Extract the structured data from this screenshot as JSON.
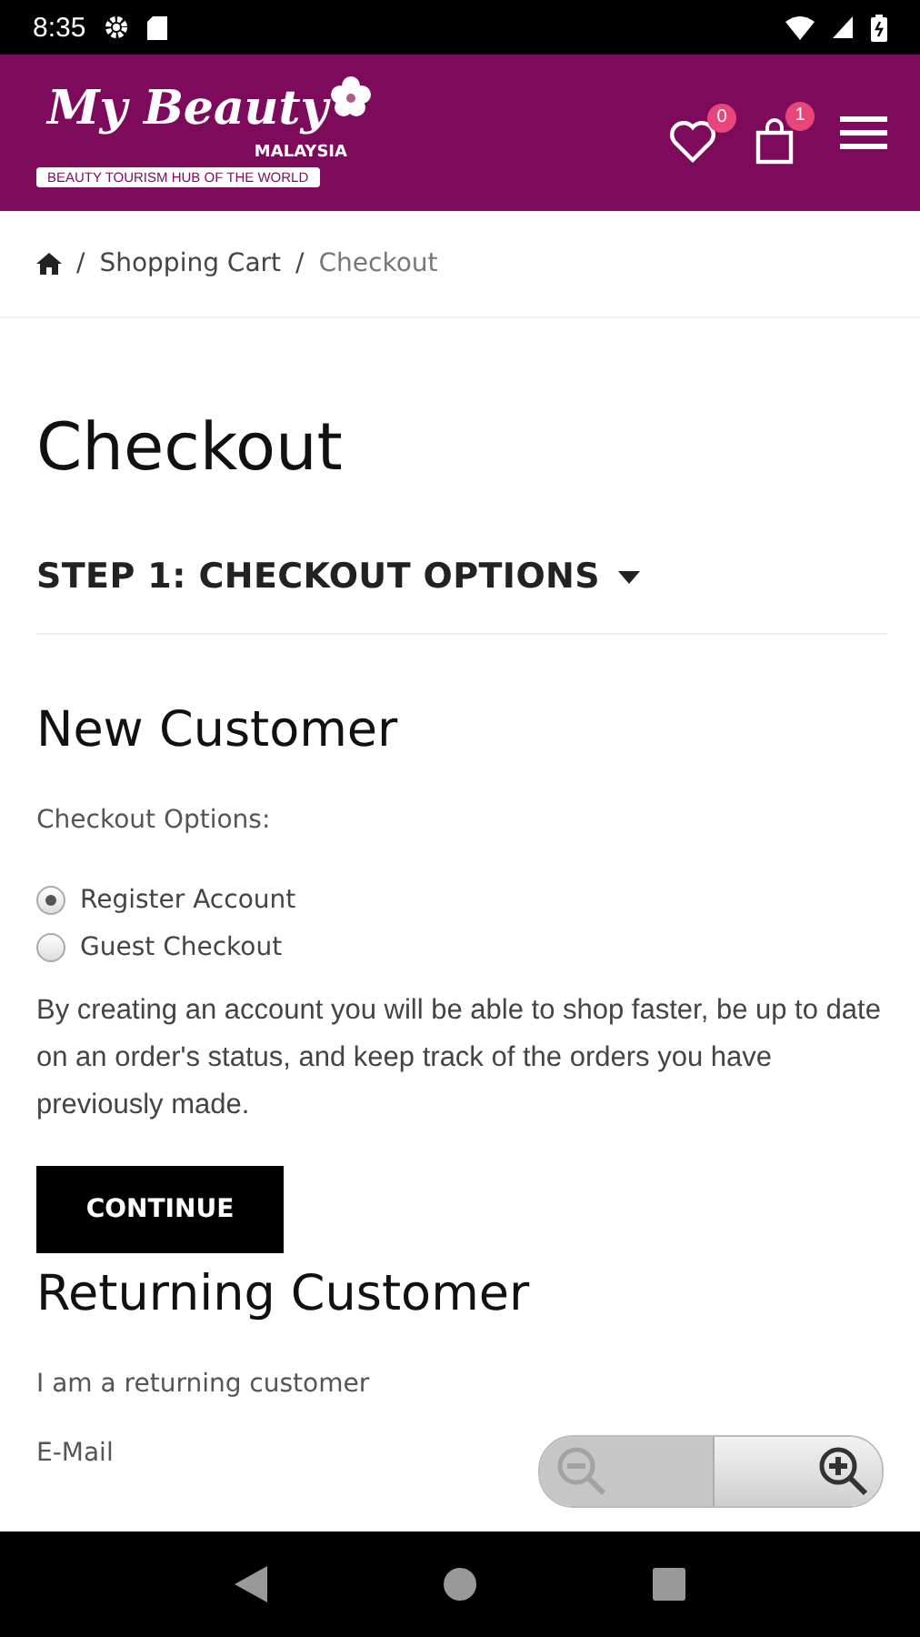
{
  "status_bar": {
    "time": "8:35"
  },
  "header": {
    "logo": {
      "script": "My Beauty",
      "subtitle": "MALAYSIA",
      "tagline": "BEAUTY TOURISM HUB OF THE WORLD"
    },
    "wishlist_count": "0",
    "cart_count": "1"
  },
  "breadcrumb": [
    {
      "separator": "/",
      "label": "Shopping Cart"
    },
    {
      "separator": "/",
      "label": "Checkout"
    }
  ],
  "page_title": "Checkout",
  "step": {
    "title": "STEP 1: CHECKOUT OPTIONS",
    "expanded": true
  },
  "new_customer": {
    "heading": "New Customer",
    "options_label": "Checkout Options:",
    "options": [
      {
        "label": "Register Account",
        "selected": true
      },
      {
        "label": "Guest Checkout",
        "selected": false
      }
    ],
    "description": "By creating an account you will be able to shop faster, be up to date on an order's status, and keep track of the orders you have previously made.",
    "button": "CONTINUE"
  },
  "returning_customer": {
    "heading": "Returning Customer",
    "text": "I am a returning customer",
    "email_label": "E-Mail"
  },
  "zoom_control": {
    "zoom_out_disabled": true,
    "zoom_in_disabled": false
  }
}
